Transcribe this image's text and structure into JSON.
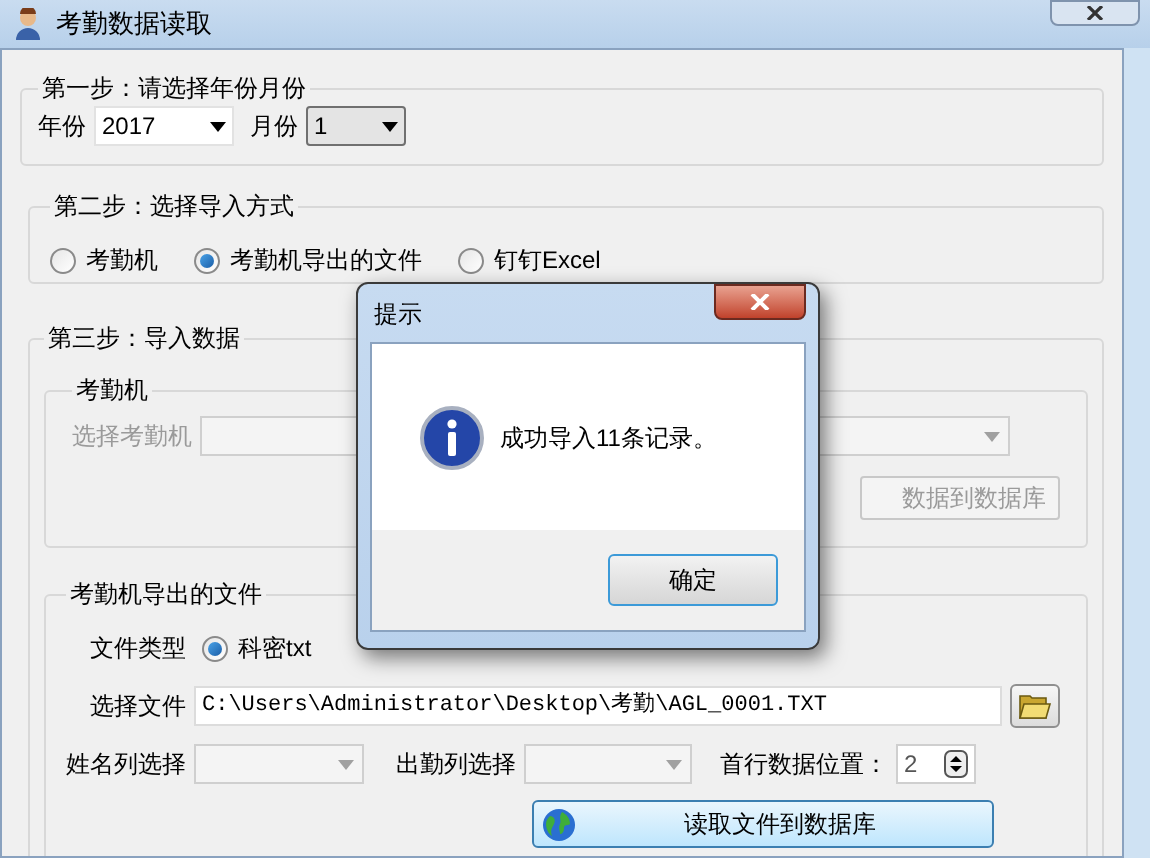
{
  "window": {
    "title": "考勤数据读取"
  },
  "step1": {
    "legend": "第一步：请选择年份月份",
    "year_label": "年份",
    "year": "2017",
    "month_label": "月份",
    "month": "1"
  },
  "step2": {
    "legend": "第二步：选择导入方式",
    "options": [
      {
        "label": "考勤机",
        "selected": false
      },
      {
        "label": "考勤机导出的文件",
        "selected": true
      },
      {
        "label": "钉钉Excel",
        "selected": false
      }
    ]
  },
  "step3": {
    "legend": "第三步：导入数据",
    "device": {
      "legend": "考勤机",
      "disabled": true,
      "select_label": "选择考勤机",
      "button": "数据到数据库"
    },
    "file": {
      "legend": "考勤机导出的文件",
      "type_label": "文件类型",
      "types": [
        {
          "label": "科密txt",
          "selected": true
        }
      ],
      "file_label": "选择文件",
      "path": "C:\\Users\\Administrator\\Desktop\\考勤\\AGL_0001.TXT",
      "name_col_label": "姓名列选择",
      "attend_col_label": "出勤列选择",
      "first_row_label": "首行数据位置：",
      "first_row": "2",
      "read_button": "读取文件到数据库"
    }
  },
  "dialog": {
    "title": "提示",
    "message": "成功导入11条记录。",
    "ok": "确定"
  }
}
